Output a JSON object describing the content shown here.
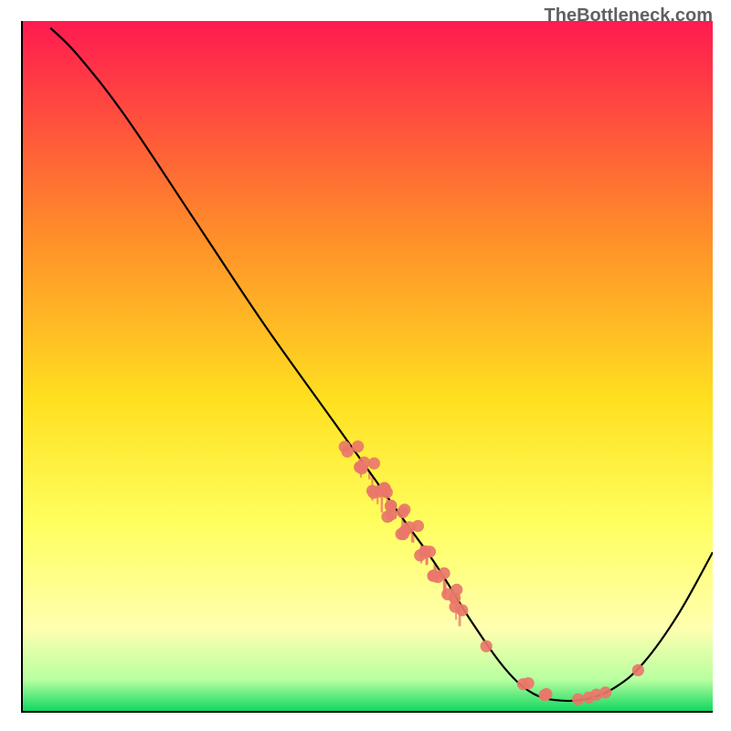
{
  "attribution": "TheBottleneck.com",
  "chart_data": {
    "type": "line",
    "title": "",
    "xlabel": "",
    "ylabel": "",
    "xlim": [
      0,
      100
    ],
    "ylim": [
      0,
      100
    ],
    "gradient_colors": {
      "top": "#ff1a50",
      "upper_mid": "#ff8a2a",
      "mid": "#ffe020",
      "lower_mid": "#ffff60",
      "lower": "#ffffb0",
      "bottom_light": "#b8ffa0",
      "bottom": "#10d860"
    },
    "curve": [
      {
        "x": 4.0,
        "y": 99.0
      },
      {
        "x": 8.0,
        "y": 95.0
      },
      {
        "x": 15.0,
        "y": 86.0
      },
      {
        "x": 25.0,
        "y": 71.0
      },
      {
        "x": 35.0,
        "y": 56.0
      },
      {
        "x": 45.0,
        "y": 42.0
      },
      {
        "x": 55.0,
        "y": 28.0
      },
      {
        "x": 60.0,
        "y": 21.0
      },
      {
        "x": 65.0,
        "y": 13.0
      },
      {
        "x": 70.0,
        "y": 6.0
      },
      {
        "x": 74.0,
        "y": 2.5
      },
      {
        "x": 78.0,
        "y": 1.5
      },
      {
        "x": 82.0,
        "y": 1.8
      },
      {
        "x": 86.0,
        "y": 3.5
      },
      {
        "x": 90.0,
        "y": 7.0
      },
      {
        "x": 95.0,
        "y": 14.0
      },
      {
        "x": 100.0,
        "y": 23.0
      }
    ],
    "dot_clusters": [
      {
        "cx": 47.5,
        "cy": 38,
        "count": 3,
        "spread": 1.2
      },
      {
        "cx": 49.5,
        "cy": 35,
        "count": 5,
        "spread": 1.5
      },
      {
        "cx": 52.0,
        "cy": 32,
        "count": 7,
        "spread": 1.8
      },
      {
        "cx": 54.0,
        "cy": 29,
        "count": 6,
        "spread": 1.5
      },
      {
        "cx": 56.0,
        "cy": 26,
        "count": 5,
        "spread": 1.4
      },
      {
        "cx": 58.0,
        "cy": 23,
        "count": 4,
        "spread": 1.2
      },
      {
        "cx": 60.0,
        "cy": 20,
        "count": 4,
        "spread": 1.2
      },
      {
        "cx": 62.0,
        "cy": 17,
        "count": 3,
        "spread": 1.0
      },
      {
        "cx": 63.5,
        "cy": 14.5,
        "count": 2,
        "spread": 0.9
      },
      {
        "cx": 67.5,
        "cy": 9.0,
        "count": 1,
        "spread": 0.7
      },
      {
        "cx": 72.5,
        "cy": 3.5,
        "count": 2,
        "spread": 0.9
      },
      {
        "cx": 75.5,
        "cy": 2.2,
        "count": 2,
        "spread": 0.8
      },
      {
        "cx": 80.0,
        "cy": 1.6,
        "count": 1,
        "spread": 0.5
      },
      {
        "cx": 82.5,
        "cy": 1.9,
        "count": 2,
        "spread": 0.8
      },
      {
        "cx": 84.5,
        "cy": 2.7,
        "count": 1,
        "spread": 0.5
      },
      {
        "cx": 89.0,
        "cy": 6.0,
        "count": 1,
        "spread": 0.5
      }
    ],
    "drip_regions": [
      {
        "x_start": 49,
        "x_end": 64,
        "base_y_offset": 0.3,
        "length_min": 0.5,
        "length_max": 3.2,
        "density": 22
      }
    ],
    "dot_color": "#e97769",
    "drip_color": "#e97769"
  }
}
